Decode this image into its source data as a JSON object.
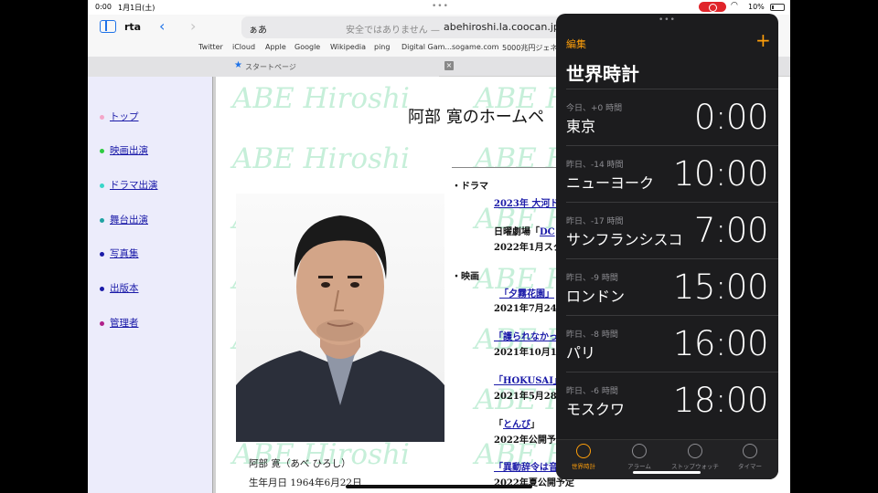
{
  "status_bar": {
    "time": "0:00",
    "date": "1月1日(土)",
    "battery": "10%",
    "accent_record_color": "#e0242a"
  },
  "safari": {
    "tab_group": "rta",
    "address": {
      "aa": "ぁあ",
      "warning": "安全ではありません —",
      "host": "abehiroshi.la.coocan.jp"
    },
    "favorites": [
      "Twitter",
      "iCloud",
      "Apple",
      "Google",
      "Wikipedia",
      "ping",
      "Digital Gam...sogame.com",
      "5000兆円ジェネ"
    ],
    "tabs": [
      {
        "title": "スタートページ"
      }
    ],
    "accent_color": "#1e72e8"
  },
  "site": {
    "nav": [
      {
        "label": "トップ",
        "color": "#f4a6c8"
      },
      {
        "label": "映画出演",
        "color": "#2ecc40"
      },
      {
        "label": "ドラマ出演",
        "color": "#39d6c9"
      },
      {
        "label": "舞台出演",
        "color": "#1fa3a3"
      },
      {
        "label": "写真集",
        "color": "#1a1aa8"
      },
      {
        "label": "出版本",
        "color": "#1a1aa8"
      },
      {
        "label": "管理者",
        "color": "#b0208a"
      }
    ],
    "watermark": "ABE Hiroshi",
    "title": "阿部 寛のホームペ",
    "caption_name": "阿部 寛（あべ ひろし）",
    "caption_birth": "生年月日 1964年6月22日",
    "news": {
      "drama_head": "・ドラマ",
      "drama_1": "2023年 大河ド",
      "drama_2_prefix": "日曜劇場「",
      "drama_2_link": "DC",
      "drama_2_date": "2022年1月スタ",
      "movie_head": "・映画",
      "movie_1": "「夕霧花園」",
      "movie_1_date": "2021年7月24日",
      "movie_2": "「護られなかっ",
      "movie_2_date": "2021年10月1日",
      "movie_3": "「HOKUSAI」",
      "movie_3_date": "2021年5月28日",
      "movie_4_prefix": "「",
      "movie_4_link": "とんび",
      "movie_4_suffix": "」",
      "movie_4_date": "2022年公開予定",
      "movie_5": "「異動辞令は音",
      "movie_5_date": "2022年夏公開予定"
    }
  },
  "clock_app": {
    "edit": "編集",
    "add": "+",
    "title": "世界時計",
    "accent_color": "#ff9f0a",
    "cities": [
      {
        "offset": "今日、+0 時間",
        "city": "東京",
        "time": "0:00"
      },
      {
        "offset": "昨日、-14 時間",
        "city": "ニューヨーク",
        "time": "10:00"
      },
      {
        "offset": "昨日、-17 時間",
        "city": "サンフランシスコ",
        "time": "7:00"
      },
      {
        "offset": "昨日、-9 時間",
        "city": "ロンドン",
        "time": "15:00"
      },
      {
        "offset": "昨日、-8 時間",
        "city": "パリ",
        "time": "16:00"
      },
      {
        "offset": "昨日、-6 時間",
        "city": "モスクワ",
        "time": "18:00"
      }
    ],
    "tabs": [
      {
        "label": "世界時計",
        "icon": "globe-icon",
        "active": true
      },
      {
        "label": "アラーム",
        "icon": "alarm-clock-icon",
        "active": false
      },
      {
        "label": "ストップウォッチ",
        "icon": "stopwatch-icon",
        "active": false
      },
      {
        "label": "タイマー",
        "icon": "timer-icon",
        "active": false
      }
    ]
  }
}
